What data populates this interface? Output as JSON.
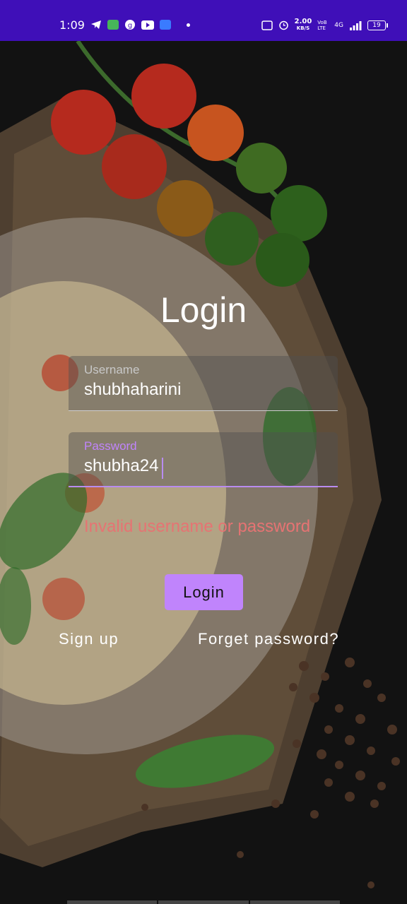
{
  "status_bar": {
    "time": "1:09",
    "speed_value": "2.00",
    "speed_unit": "KB/S",
    "volte": "VoB LTE",
    "network": "4G",
    "battery": "19"
  },
  "login": {
    "title": "Login",
    "username": {
      "label": "Username",
      "value": "shubhaharini"
    },
    "password": {
      "label": "Password",
      "value": "shubha24"
    },
    "error": "Invalid username or password",
    "login_button": "Login",
    "signup_link": "Sign up",
    "forgot_link": "Forget password?"
  },
  "colors": {
    "status_bar": "#3f0fb8",
    "accent": "#c084fc",
    "error": "#e67373",
    "background": "#121212"
  }
}
